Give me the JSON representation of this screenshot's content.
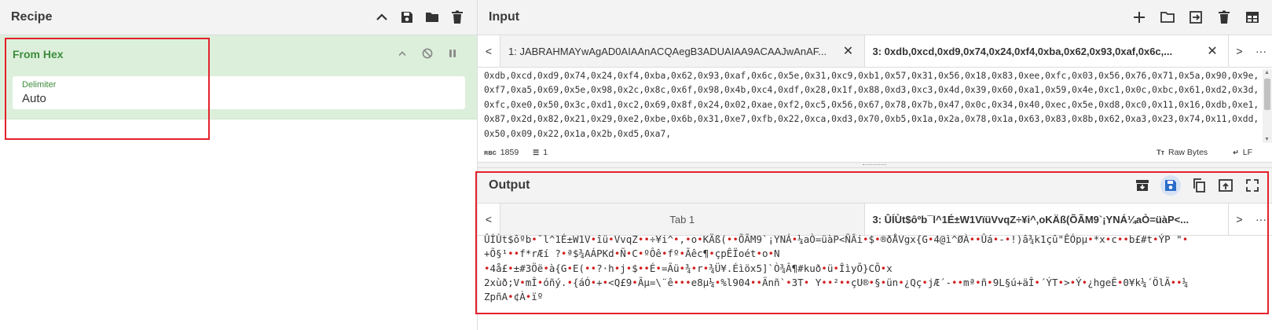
{
  "recipe": {
    "title": "Recipe",
    "icons": [
      "chevron-up-icon",
      "save-icon",
      "folder-icon",
      "trash-icon"
    ],
    "operation": {
      "name": "From Hex",
      "arg_label": "Delimiter",
      "arg_value": "Auto"
    }
  },
  "input": {
    "title": "Input",
    "tabs": [
      {
        "label": "1: JABRAHMAYwAgAD0AIAAnACQAegB3ADUAIAA9ACAAJwAnAF...",
        "active": false
      },
      {
        "label": "3: 0xdb,0xcd,0xd9,0x74,0x24,0xf4,0xba,0x62,0x93,0xaf,0x6c,...",
        "active": true
      }
    ],
    "content": "0xdb,0xcd,0xd9,0x74,0x24,0xf4,0xba,0x62,0x93,0xaf,0x6c,0x5e,0x31,0xc9,0xb1,0x57,0x31,0x56,0x18,0x83,0xee,0xfc,0x03,0x56,0x76,0x71,0x5a,0x90,0x9e,0xf7,0xa5,0x69,0x5e,0x98,0x2c,0x8c,0x6f,0x98,0x4b,0xc4,0xdf,0x28,0x1f,0x88,0xd3,0xc3,0x4d,0x39,0x60,0xa1,0x59,0x4e,0xc1,0x0c,0xbc,0x61,0xd2,0x3d,0xfc,0xe0,0x50,0x3c,0xd1,0xc2,0x69,0x8f,0x24,0x02,0xae,0xf2,0xc5,0x56,0x67,0x78,0x7b,0x47,0x0c,0x34,0x40,0xec,0x5e,0xd8,0xc0,0x11,0x16,0xdb,0xe1,0x87,0x2d,0x82,0x21,0x29,0xe2,0xbe,0x6b,0x31,0xe7,0xfb,0x22,0xca,0xd3,0x70,0xb5,0x1a,0x2a,0x78,0x1a,0x63,0x83,0x8b,0x62,0xa3,0x23,0x74,0x11,0xdd,0x50,0x09,0x22,0x1a,0x2b,0xd5,0xa7,",
    "status": {
      "length": "1859",
      "lines": "1",
      "raw_bytes": "Raw Bytes",
      "eol": "LF"
    }
  },
  "output": {
    "title": "Output",
    "tabs": [
      {
        "label": "Tab 1",
        "active": false
      },
      {
        "label": "3: ÛÍÙt$ôºb¯l^1É±W1VïüVvqZ÷¥i^,oKÄß(ÕÃM9`¡YNÁ¼aÒ=üàP<...",
        "active": true
      }
    ],
    "lines": [
      "ÛÍÙt$ôºb•¯l^1É±W1V•îü•VvqZ••÷¥i^•,•o•KÄß(••ÕÃM9`¡YNÁ•¼aÒ=üàP<ÑÂi•$•®ðÅVgx{G•4@ì^ØÀ••Ûá•-•!)â¾k1çû\"ÊÓpµ•*x•c••b£#t•ÝP  \"•",
      "+Õ§¹••f*rÆí ?•ª$¾AÁPKd•Ñ•C•ºÔê•fº•Ãêc¶•çpÊÏoét•o•N",
      "•4å£•±#3Öë•à{G•E(••?·h•j•$••É•=Ãü•¾•r•¾Ü¥.Éìöx5]`Ò¾Â¶#kuð•ü•ÎìyÕ}CÕ•x",
      "2xùð;V•mÎ•óñý.•{áÓ•+•<Q£9•Ãµ=\\¨ê•••e8µ¼•%l904••Änñ`•3T• Y••²••çU®•§•ün•¿Qç•jÆ´-••mª•ñ•9L§ú+äÎ•´ÝT•>•Ý•¿hgeÊ•0¥k¼´ÖlÃ••¼",
      "ZpñA•¢À•ïº"
    ]
  }
}
